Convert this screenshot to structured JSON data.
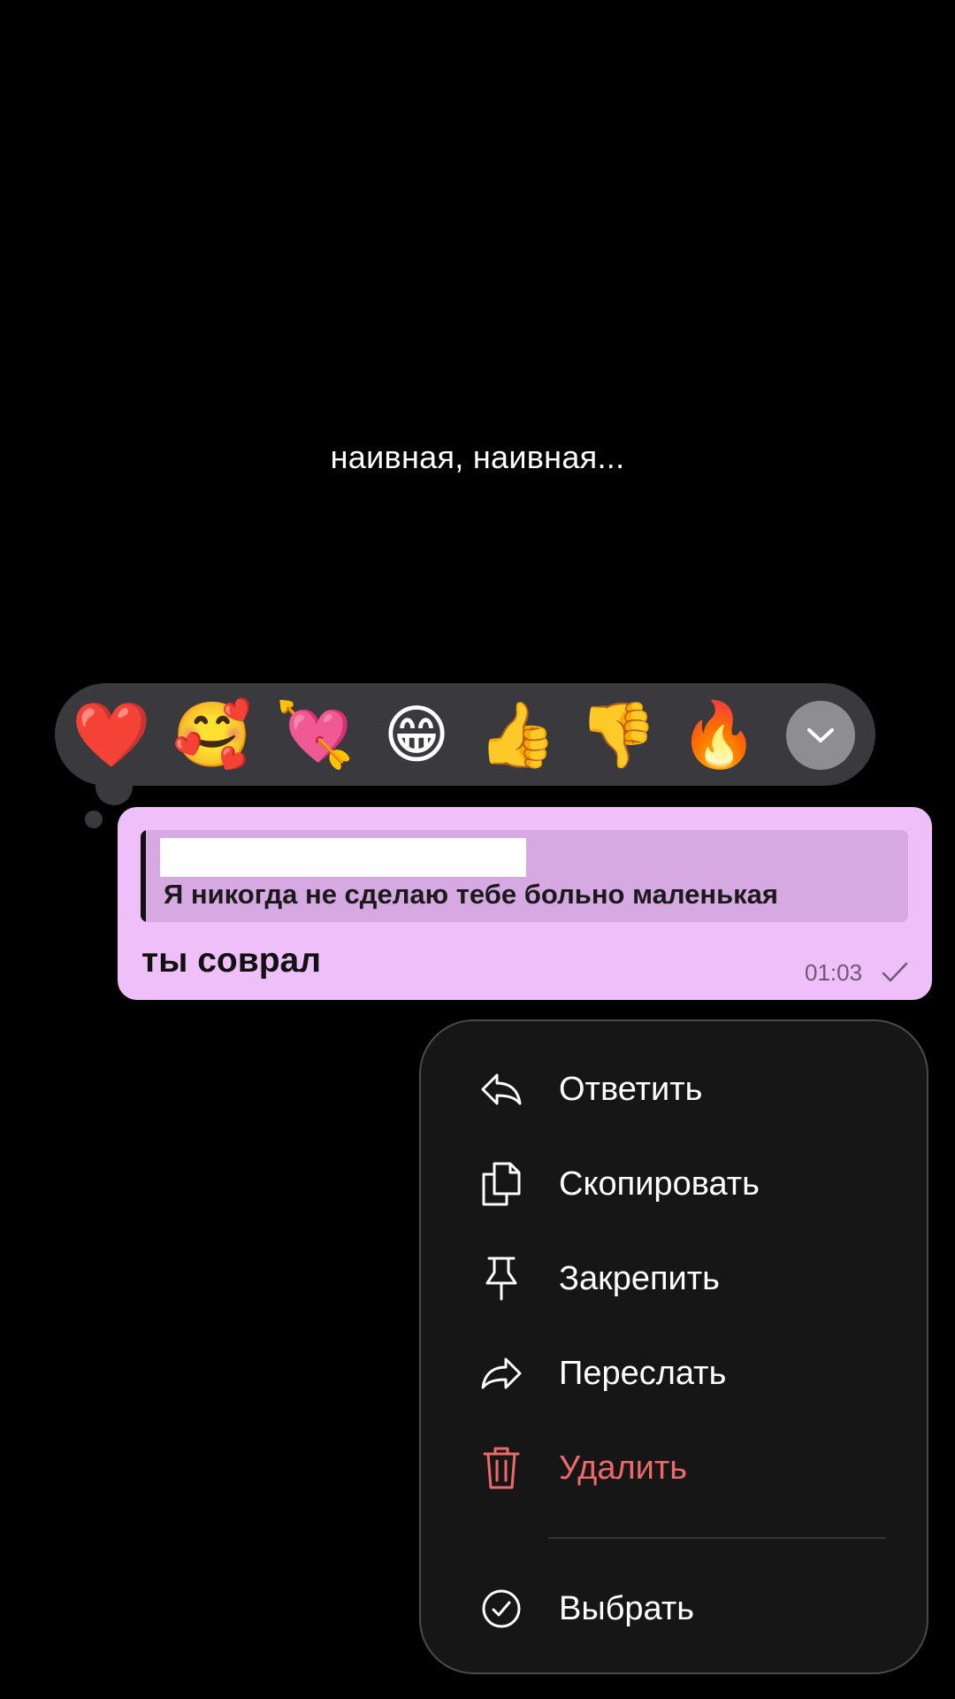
{
  "caption": "наивная, наивная...",
  "reactions": [
    {
      "emoji": "❤️",
      "icon": "red-heart"
    },
    {
      "emoji": "🥰",
      "icon": "smiling-face-with-hearts"
    },
    {
      "emoji": "💘",
      "icon": "heart-with-arrow"
    },
    {
      "emoji": "😁",
      "icon": "beaming-face"
    },
    {
      "emoji": "👍",
      "icon": "thumbs-up"
    },
    {
      "emoji": "👎",
      "icon": "thumbs-down"
    },
    {
      "emoji": "🔥",
      "icon": "fire"
    }
  ],
  "message": {
    "reply_text": "Я никогда не сделаю тебе больно маленькая",
    "text": "ты соврал",
    "time": "01:03",
    "status_icon": "check-icon"
  },
  "menu": {
    "items": [
      {
        "label": "Ответить",
        "icon": "reply-icon"
      },
      {
        "label": "Скопировать",
        "icon": "copy-icon"
      },
      {
        "label": "Закрепить",
        "icon": "pin-icon"
      },
      {
        "label": "Переслать",
        "icon": "forward-icon"
      },
      {
        "label": "Удалить",
        "icon": "trash-icon"
      },
      {
        "label": "Выбрать",
        "icon": "select-icon"
      }
    ]
  },
  "colors": {
    "bubble": "#efbffa",
    "reply_bg": "#d6a9e2",
    "reaction_bar": "#3a3a3e",
    "menu_bg": "#161616",
    "delete": "#ee6a6a"
  }
}
